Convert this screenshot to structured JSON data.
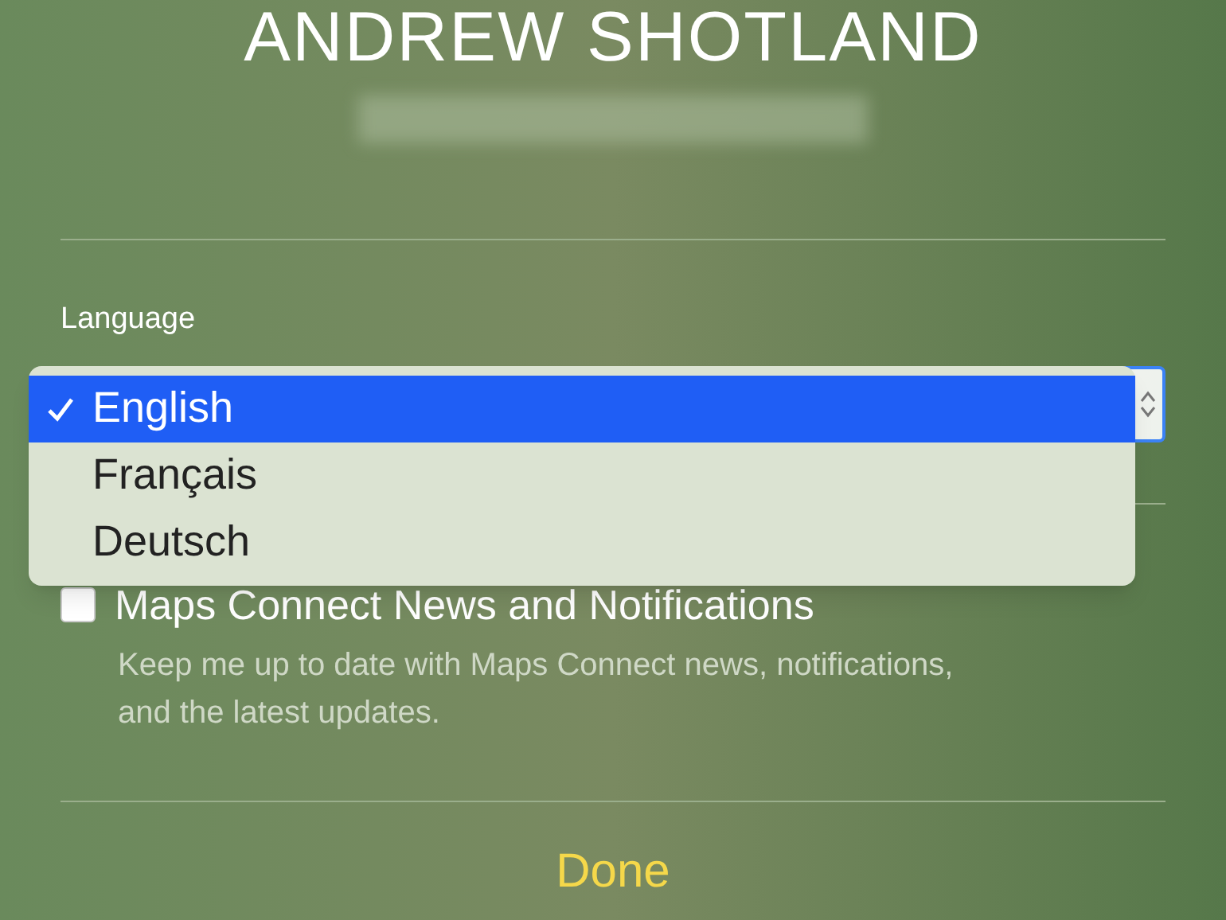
{
  "profile": {
    "name": "ANDREW SHOTLAND"
  },
  "language": {
    "label": "Language",
    "expanded": true,
    "options": [
      {
        "label": "English",
        "selected": true
      },
      {
        "label": "Français",
        "selected": false
      },
      {
        "label": "Deutsch",
        "selected": false
      }
    ]
  },
  "newsletter": {
    "label": "Maps Connect News and Notifications",
    "checked": false,
    "description": "Keep me up to date with Maps Connect news, notifications, and the latest updates."
  },
  "done_button": "Done"
}
